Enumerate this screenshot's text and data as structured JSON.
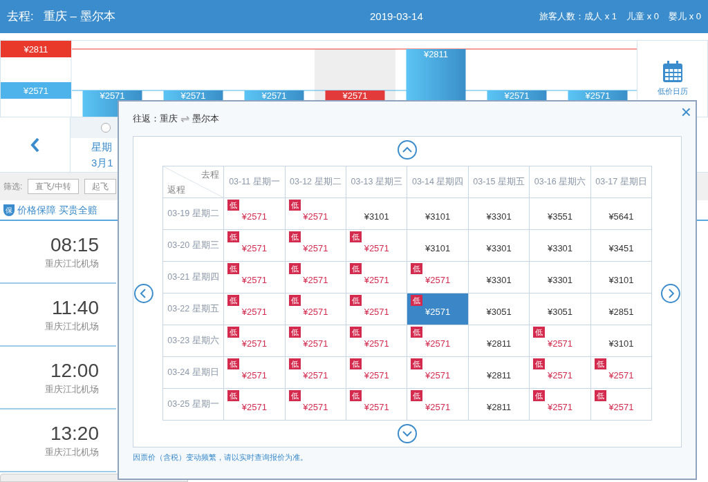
{
  "header": {
    "trip_label": "去程:",
    "route": "重庆 – 墨尔本",
    "date": "2019-03-14",
    "passengers": "旅客人数：成人 x 1",
    "children": "儿童 x 0",
    "infants": "婴儿 x 0"
  },
  "price_chart": {
    "chart_data": {
      "type": "bar",
      "values": [
        2571,
        2571,
        2571,
        2571,
        2811,
        2571,
        2571
      ],
      "value_labels": [
        "¥2571",
        "¥2571",
        "¥2571",
        "¥2571",
        "¥2811",
        "¥2571",
        "¥2571"
      ],
      "ylim": [
        2411,
        2811
      ],
      "ref_lines": [
        {
          "axis": "y",
          "value": 2811,
          "color": "#e8392b"
        },
        {
          "axis": "y",
          "value": 2571,
          "color": "#4db3ea"
        }
      ],
      "yticks": [
        {
          "value": 2811,
          "label": "¥2811"
        },
        {
          "value": 2571,
          "label": "¥2571"
        }
      ]
    },
    "days": [
      {
        "selected": false
      },
      {
        "selected": false
      },
      {
        "selected": false
      },
      {
        "selected": true
      },
      {
        "selected": false
      },
      {
        "selected": false
      },
      {
        "selected": false
      }
    ]
  },
  "calendar_button": "低价日历",
  "day_tab": {
    "weekday": "星期",
    "date": "3月1",
    "selected": false
  },
  "filter": {
    "label": "筛选:",
    "options": [
      "直飞/中转",
      "起飞"
    ]
  },
  "guarantee": {
    "badge": "保",
    "text": "价格保障 买贵全赔"
  },
  "flights": [
    {
      "time": "08:15",
      "airport": "重庆江北机场"
    },
    {
      "time": "11:40",
      "airport": "重庆江北机场"
    },
    {
      "time": "12:00",
      "airport": "重庆江北机场"
    },
    {
      "time": "13:20",
      "airport": "重庆江北机场"
    }
  ],
  "modal": {
    "title": "往返：重庆",
    "swap": "⇌",
    "destination": "墨尔本",
    "close": "×",
    "corner_top": "去程",
    "corner_bottom": "返程",
    "columns": [
      "03-11 星期一",
      "03-12 星期二",
      "03-13 星期三",
      "03-14 星期四",
      "03-15 星期五",
      "03-16 星期六",
      "03-17 星期日"
    ],
    "rows": [
      {
        "label": "03-19 星期二",
        "cells": [
          {
            "price": "¥2571",
            "tag": "低",
            "selected": false
          },
          {
            "price": "¥2571",
            "tag": "低",
            "selected": false
          },
          {
            "price": "¥3101",
            "selected": false
          },
          {
            "price": "¥3101",
            "selected": false
          },
          {
            "price": "¥3301",
            "selected": false
          },
          {
            "price": "¥3551",
            "selected": false
          },
          {
            "price": "¥5641",
            "selected": false
          }
        ]
      },
      {
        "label": "03-20 星期三",
        "cells": [
          {
            "price": "¥2571",
            "tag": "低",
            "selected": false
          },
          {
            "price": "¥2571",
            "tag": "低",
            "selected": false
          },
          {
            "price": "¥2571",
            "tag": "低",
            "selected": false
          },
          {
            "price": "¥3101",
            "selected": false
          },
          {
            "price": "¥3301",
            "selected": false
          },
          {
            "price": "¥3301",
            "selected": false
          },
          {
            "price": "¥3451",
            "selected": false
          }
        ]
      },
      {
        "label": "03-21 星期四",
        "cells": [
          {
            "price": "¥2571",
            "tag": "低",
            "selected": false
          },
          {
            "price": "¥2571",
            "tag": "低",
            "selected": false
          },
          {
            "price": "¥2571",
            "tag": "低",
            "selected": false
          },
          {
            "price": "¥2571",
            "tag": "低",
            "selected": false
          },
          {
            "price": "¥3301",
            "selected": false
          },
          {
            "price": "¥3301",
            "selected": false
          },
          {
            "price": "¥3101",
            "selected": false
          }
        ]
      },
      {
        "label": "03-22 星期五",
        "cells": [
          {
            "price": "¥2571",
            "tag": "低",
            "selected": false
          },
          {
            "price": "¥2571",
            "tag": "低",
            "selected": false
          },
          {
            "price": "¥2571",
            "tag": "低",
            "selected": false
          },
          {
            "price": "¥2571",
            "tag": "低",
            "selected": true
          },
          {
            "price": "¥3051",
            "selected": false
          },
          {
            "price": "¥3051",
            "selected": false
          },
          {
            "price": "¥2851",
            "selected": false
          }
        ]
      },
      {
        "label": "03-23 星期六",
        "cells": [
          {
            "price": "¥2571",
            "tag": "低",
            "selected": false
          },
          {
            "price": "¥2571",
            "tag": "低",
            "selected": false
          },
          {
            "price": "¥2571",
            "tag": "低",
            "selected": false
          },
          {
            "price": "¥2571",
            "tag": "低",
            "selected": false
          },
          {
            "price": "¥2811",
            "selected": false
          },
          {
            "price": "¥2571",
            "tag": "低",
            "selected": false
          },
          {
            "price": "¥3101",
            "selected": false
          }
        ]
      },
      {
        "label": "03-24 星期日",
        "cells": [
          {
            "price": "¥2571",
            "tag": "低",
            "selected": false
          },
          {
            "price": "¥2571",
            "tag": "低",
            "selected": false
          },
          {
            "price": "¥2571",
            "tag": "低",
            "selected": false
          },
          {
            "price": "¥2571",
            "tag": "低",
            "selected": false
          },
          {
            "price": "¥2811",
            "selected": false
          },
          {
            "price": "¥2571",
            "tag": "低",
            "selected": false
          },
          {
            "price": "¥2571",
            "tag": "低",
            "selected": false
          }
        ]
      },
      {
        "label": "03-25 星期一",
        "cells": [
          {
            "price": "¥2571",
            "tag": "低",
            "selected": false
          },
          {
            "price": "¥2571",
            "tag": "低",
            "selected": false
          },
          {
            "price": "¥2571",
            "tag": "低",
            "selected": false
          },
          {
            "price": "¥2571",
            "tag": "低",
            "selected": false
          },
          {
            "price": "¥2811",
            "selected": false
          },
          {
            "price": "¥2571",
            "tag": "低",
            "selected": false
          },
          {
            "price": "¥2571",
            "tag": "低",
            "selected": false
          }
        ]
      }
    ],
    "note": "因票价（含税）变动频繁，请以实时查询报价为准。"
  }
}
